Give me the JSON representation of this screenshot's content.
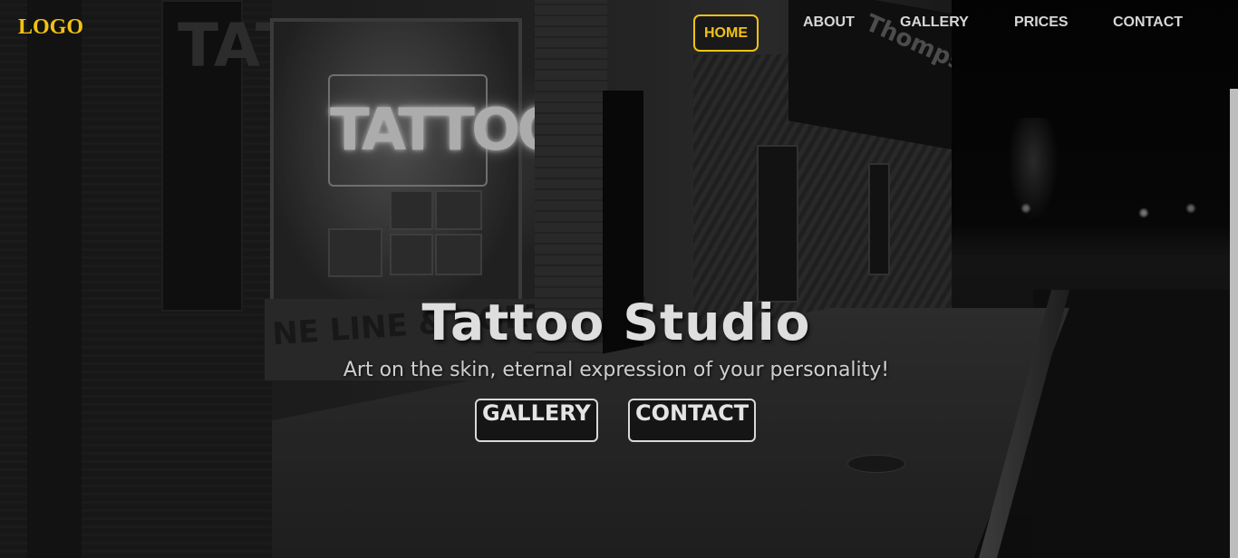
{
  "header": {
    "logo": "LOGO",
    "nav": [
      {
        "label": "HOME",
        "active": true
      },
      {
        "label": "ABOUT",
        "active": false
      },
      {
        "label": "GALLERY",
        "active": false
      },
      {
        "label": "PRICES",
        "active": false
      },
      {
        "label": "CONTACT",
        "active": false
      }
    ]
  },
  "hero": {
    "title": "Tattoo Studio",
    "subtitle": "Art on the skin, eternal expression of your personality!",
    "buttons": [
      "GALLERY",
      "CONTACT"
    ],
    "background_signage": {
      "neon": "TATTOO",
      "vertical_sign": "TATTOO",
      "window_text": "NE LINE & PORTRAITS",
      "awning": "Thompson"
    }
  },
  "colors": {
    "accent": "#f2c213",
    "nav_text": "#d7d7d7",
    "title": "#dedede"
  }
}
